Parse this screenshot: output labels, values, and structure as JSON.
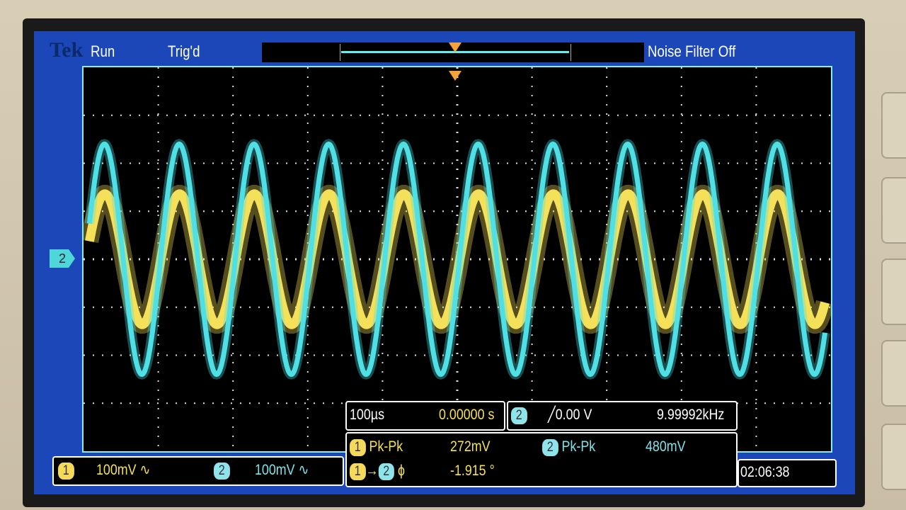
{
  "header": {
    "brand": "Tek",
    "run_state": "Run",
    "trigger_state": "Trig'd",
    "noise_filter": "Noise Filter Off"
  },
  "channel_marker": "2",
  "timebase": {
    "scale": "100µs",
    "position": "0.00000 s"
  },
  "trigger": {
    "source": "2",
    "slope_level": "╱0.00 V",
    "frequency": "9.99992kHz"
  },
  "measurements": {
    "m1_ch": "1",
    "m1_label": "Pk-Pk",
    "m1_value": "272mV",
    "m2_ch": "2",
    "m2_label": "Pk-Pk",
    "m2_value": "480mV",
    "phase_from": "1",
    "phase_arrow": "→",
    "phase_to": "2",
    "phase_symbol": "ϕ",
    "phase_value": "-1.915 °"
  },
  "channels": {
    "ch1_num": "1",
    "ch1_scale": "100mV ∿",
    "ch2_num": "2",
    "ch2_scale": "100mV ∿"
  },
  "clock": "02:06:38",
  "colors": {
    "ch1": "#f5e05a",
    "ch2": "#4fe0e6",
    "screen_blue": "#1c47b8"
  },
  "chart_data": {
    "type": "line",
    "title": "",
    "xlabel": "time (100 µs/div)",
    "ylabel": "voltage (100 mV/div)",
    "xlim": [
      -500,
      500
    ],
    "ylim": [
      -400,
      400
    ],
    "x_unit": "µs",
    "y_unit": "mV",
    "grid": true,
    "x_divisions": 10,
    "y_divisions": 8,
    "series": [
      {
        "name": "CH1",
        "color": "#f5e05a",
        "shape": "sine",
        "frequency_khz": 9.99992,
        "peak_to_peak_mv": 272,
        "phase_deg": -1.915,
        "offset_mv": 0
      },
      {
        "name": "CH2",
        "color": "#4fe0e6",
        "shape": "sine",
        "frequency_khz": 9.99992,
        "peak_to_peak_mv": 480,
        "phase_deg": 0,
        "offset_mv": 0
      }
    ]
  }
}
